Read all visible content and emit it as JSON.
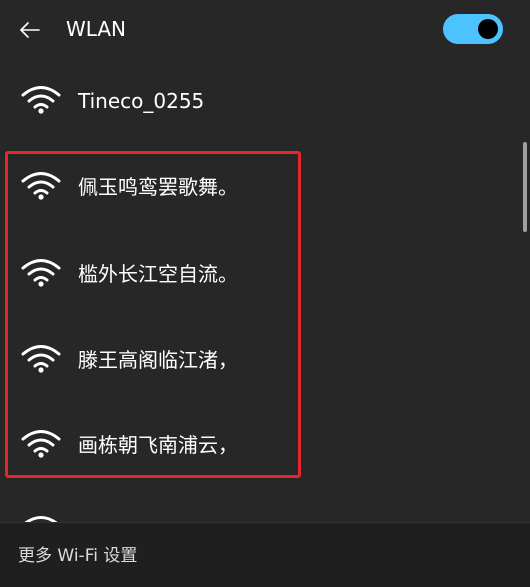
{
  "header": {
    "back_icon": "back-arrow-icon",
    "title": "WLAN",
    "wifi_enabled": true
  },
  "networks": [
    {
      "name": "Tineco_0255",
      "icon": "wifi-signal-icon",
      "signal_bars": 4
    },
    {
      "name": "佩玉鸣鸾罢歌舞。",
      "icon": "wifi-signal-icon",
      "signal_bars": 4
    },
    {
      "name": "槛外长江空自流。",
      "icon": "wifi-signal-icon",
      "signal_bars": 4
    },
    {
      "name": "滕王高阁临江渚，",
      "icon": "wifi-signal-icon",
      "signal_bars": 4
    },
    {
      "name": "画栋朝飞南浦云，",
      "icon": "wifi-signal-icon",
      "signal_bars": 4
    },
    {
      "name": "",
      "icon": "wifi-signal-icon",
      "signal_bars": 4
    }
  ],
  "footer": {
    "more_settings_label": "更多 Wi-Fi 设置"
  },
  "colors": {
    "background": "#272727",
    "footer_background": "#1f1f1f",
    "accent": "#4cc2ff",
    "highlight_border": "#e5262c"
  }
}
